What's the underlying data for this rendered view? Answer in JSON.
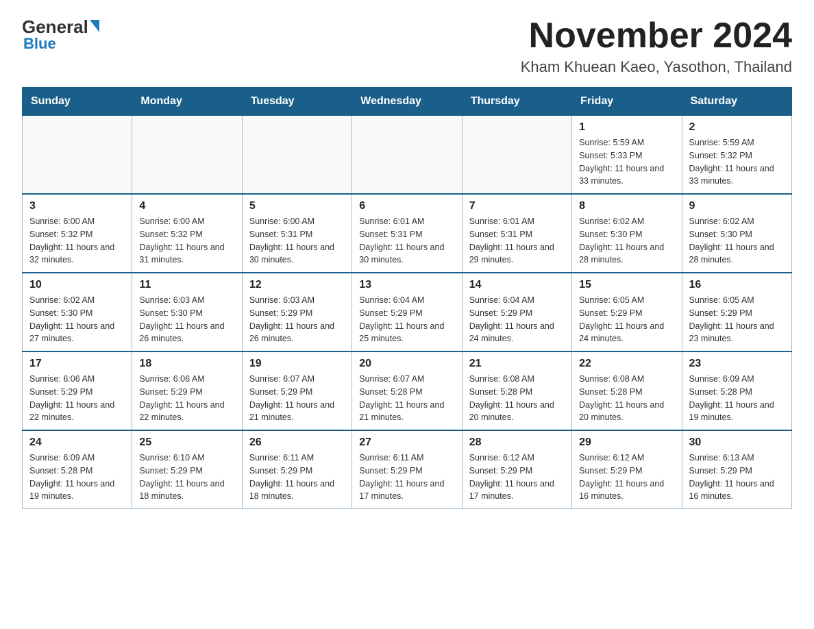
{
  "logo": {
    "general": "General",
    "blue": "Blue"
  },
  "header": {
    "month": "November 2024",
    "location": "Kham Khuean Kaeo, Yasothon, Thailand"
  },
  "days_of_week": [
    "Sunday",
    "Monday",
    "Tuesday",
    "Wednesday",
    "Thursday",
    "Friday",
    "Saturday"
  ],
  "weeks": [
    [
      {
        "day": "",
        "info": ""
      },
      {
        "day": "",
        "info": ""
      },
      {
        "day": "",
        "info": ""
      },
      {
        "day": "",
        "info": ""
      },
      {
        "day": "",
        "info": ""
      },
      {
        "day": "1",
        "info": "Sunrise: 5:59 AM\nSunset: 5:33 PM\nDaylight: 11 hours and 33 minutes."
      },
      {
        "day": "2",
        "info": "Sunrise: 5:59 AM\nSunset: 5:32 PM\nDaylight: 11 hours and 33 minutes."
      }
    ],
    [
      {
        "day": "3",
        "info": "Sunrise: 6:00 AM\nSunset: 5:32 PM\nDaylight: 11 hours and 32 minutes."
      },
      {
        "day": "4",
        "info": "Sunrise: 6:00 AM\nSunset: 5:32 PM\nDaylight: 11 hours and 31 minutes."
      },
      {
        "day": "5",
        "info": "Sunrise: 6:00 AM\nSunset: 5:31 PM\nDaylight: 11 hours and 30 minutes."
      },
      {
        "day": "6",
        "info": "Sunrise: 6:01 AM\nSunset: 5:31 PM\nDaylight: 11 hours and 30 minutes."
      },
      {
        "day": "7",
        "info": "Sunrise: 6:01 AM\nSunset: 5:31 PM\nDaylight: 11 hours and 29 minutes."
      },
      {
        "day": "8",
        "info": "Sunrise: 6:02 AM\nSunset: 5:30 PM\nDaylight: 11 hours and 28 minutes."
      },
      {
        "day": "9",
        "info": "Sunrise: 6:02 AM\nSunset: 5:30 PM\nDaylight: 11 hours and 28 minutes."
      }
    ],
    [
      {
        "day": "10",
        "info": "Sunrise: 6:02 AM\nSunset: 5:30 PM\nDaylight: 11 hours and 27 minutes."
      },
      {
        "day": "11",
        "info": "Sunrise: 6:03 AM\nSunset: 5:30 PM\nDaylight: 11 hours and 26 minutes."
      },
      {
        "day": "12",
        "info": "Sunrise: 6:03 AM\nSunset: 5:29 PM\nDaylight: 11 hours and 26 minutes."
      },
      {
        "day": "13",
        "info": "Sunrise: 6:04 AM\nSunset: 5:29 PM\nDaylight: 11 hours and 25 minutes."
      },
      {
        "day": "14",
        "info": "Sunrise: 6:04 AM\nSunset: 5:29 PM\nDaylight: 11 hours and 24 minutes."
      },
      {
        "day": "15",
        "info": "Sunrise: 6:05 AM\nSunset: 5:29 PM\nDaylight: 11 hours and 24 minutes."
      },
      {
        "day": "16",
        "info": "Sunrise: 6:05 AM\nSunset: 5:29 PM\nDaylight: 11 hours and 23 minutes."
      }
    ],
    [
      {
        "day": "17",
        "info": "Sunrise: 6:06 AM\nSunset: 5:29 PM\nDaylight: 11 hours and 22 minutes."
      },
      {
        "day": "18",
        "info": "Sunrise: 6:06 AM\nSunset: 5:29 PM\nDaylight: 11 hours and 22 minutes."
      },
      {
        "day": "19",
        "info": "Sunrise: 6:07 AM\nSunset: 5:29 PM\nDaylight: 11 hours and 21 minutes."
      },
      {
        "day": "20",
        "info": "Sunrise: 6:07 AM\nSunset: 5:28 PM\nDaylight: 11 hours and 21 minutes."
      },
      {
        "day": "21",
        "info": "Sunrise: 6:08 AM\nSunset: 5:28 PM\nDaylight: 11 hours and 20 minutes."
      },
      {
        "day": "22",
        "info": "Sunrise: 6:08 AM\nSunset: 5:28 PM\nDaylight: 11 hours and 20 minutes."
      },
      {
        "day": "23",
        "info": "Sunrise: 6:09 AM\nSunset: 5:28 PM\nDaylight: 11 hours and 19 minutes."
      }
    ],
    [
      {
        "day": "24",
        "info": "Sunrise: 6:09 AM\nSunset: 5:28 PM\nDaylight: 11 hours and 19 minutes."
      },
      {
        "day": "25",
        "info": "Sunrise: 6:10 AM\nSunset: 5:29 PM\nDaylight: 11 hours and 18 minutes."
      },
      {
        "day": "26",
        "info": "Sunrise: 6:11 AM\nSunset: 5:29 PM\nDaylight: 11 hours and 18 minutes."
      },
      {
        "day": "27",
        "info": "Sunrise: 6:11 AM\nSunset: 5:29 PM\nDaylight: 11 hours and 17 minutes."
      },
      {
        "day": "28",
        "info": "Sunrise: 6:12 AM\nSunset: 5:29 PM\nDaylight: 11 hours and 17 minutes."
      },
      {
        "day": "29",
        "info": "Sunrise: 6:12 AM\nSunset: 5:29 PM\nDaylight: 11 hours and 16 minutes."
      },
      {
        "day": "30",
        "info": "Sunrise: 6:13 AM\nSunset: 5:29 PM\nDaylight: 11 hours and 16 minutes."
      }
    ]
  ]
}
